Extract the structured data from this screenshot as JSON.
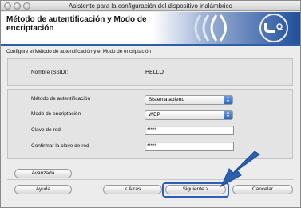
{
  "window": {
    "title": "Asistente para la configuración del dispositivo inalámbrico"
  },
  "header": {
    "title_line1": "Método de autentificación y Modo de",
    "title_line2": "encriptación",
    "logo_icon": "wifi-signal-icon"
  },
  "intro": "Configure el Método de autentificación y el Modo de encriptación",
  "ssid": {
    "label": "Nombre (SSID):",
    "value": "HELLO"
  },
  "form": {
    "auth_label": "Método de autentificación",
    "auth_value": "Sistema abierto",
    "enc_label": "Modo de encriptación",
    "enc_value": "WEP",
    "key_label": "Clave de red",
    "key_value": "*****",
    "confirm_label": "Confirmar la clave de red",
    "confirm_value": "*****"
  },
  "buttons": {
    "advanced": "Avanzada",
    "help": "Ayuda",
    "back": "< Atrás",
    "next": "Siguiente >",
    "cancel": "Cancelar"
  },
  "colors": {
    "accent": "#2e5fa8",
    "header_bg": "#ffffff",
    "panel_bg": "#e4e4e4"
  }
}
